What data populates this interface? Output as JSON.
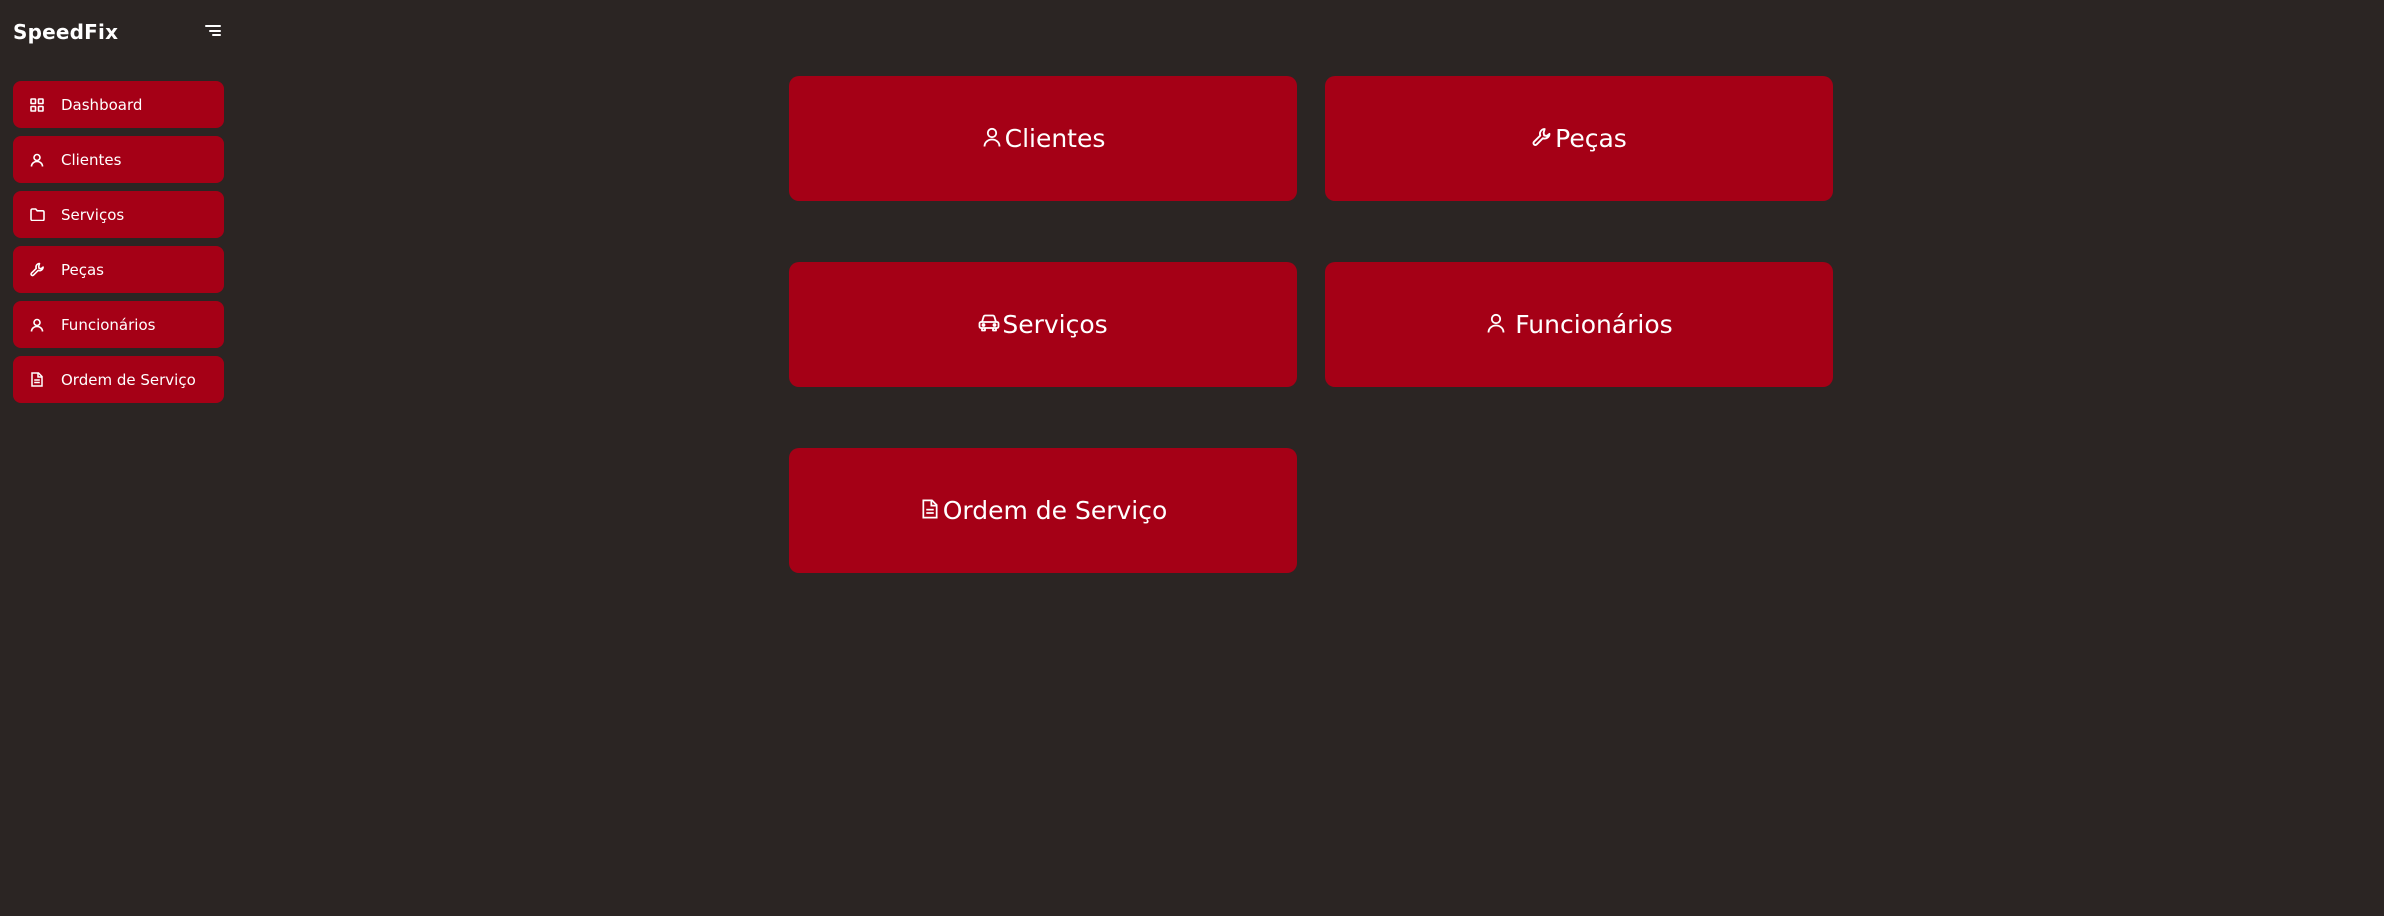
{
  "brand": {
    "name": "SpeedFix"
  },
  "sidebar": {
    "toggle_icon": "menu-lines-icon",
    "items": [
      {
        "label": "Dashboard",
        "icon": "grid-icon"
      },
      {
        "label": "Clientes",
        "icon": "user-icon"
      },
      {
        "label": "Serviços",
        "icon": "folder-icon"
      },
      {
        "label": "Peças",
        "icon": "wrench-icon"
      },
      {
        "label": "Funcionários",
        "icon": "user-icon"
      },
      {
        "label": "Ordem de Serviço",
        "icon": "document-icon"
      }
    ]
  },
  "tiles": [
    {
      "label": "Clientes",
      "icon": "user-icon"
    },
    {
      "label": "Peças",
      "icon": "wrench-icon"
    },
    {
      "label": "Serviços",
      "icon": "car-icon"
    },
    {
      "label": "Funcionários",
      "icon": "user-icon"
    },
    {
      "label": "Ordem de Serviço",
      "icon": "document-icon"
    }
  ],
  "colors": {
    "background": "#2b2523",
    "accent": "#a50016",
    "text": "#ffffff"
  }
}
